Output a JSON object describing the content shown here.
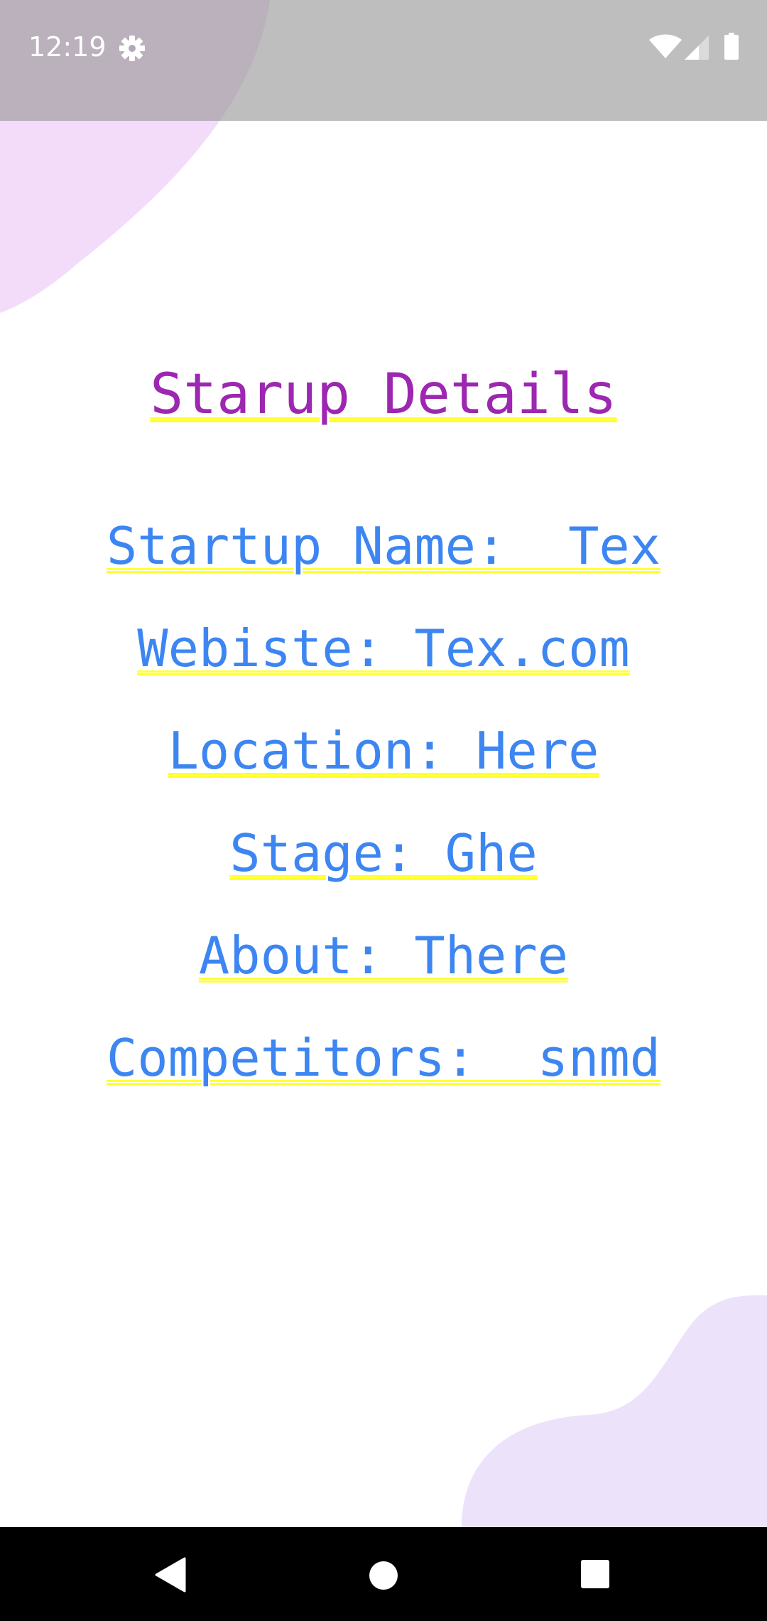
{
  "status_bar": {
    "time": "12:19",
    "icons": [
      "gear-icon",
      "wifi-icon",
      "signal-icon",
      "battery-icon"
    ]
  },
  "page": {
    "title": "Starup Details",
    "details": [
      {
        "text": "Startup Name:  Tex"
      },
      {
        "text": "Webiste: Tex.com"
      },
      {
        "text": "Location: Here"
      },
      {
        "text": "Stage: Ghe"
      },
      {
        "text": "About: There"
      },
      {
        "text": "Competitors:  snmd"
      }
    ]
  },
  "nav_bar": {
    "icons": [
      "back-icon",
      "home-icon",
      "recents-icon"
    ]
  },
  "colors": {
    "title": "#9c27b0",
    "detail_text": "#3d86f2",
    "underline": "#ffff33",
    "blob_top": "#f3dcfa",
    "blob_bottom": "#ece3fb",
    "nav_bar": "#000000"
  }
}
